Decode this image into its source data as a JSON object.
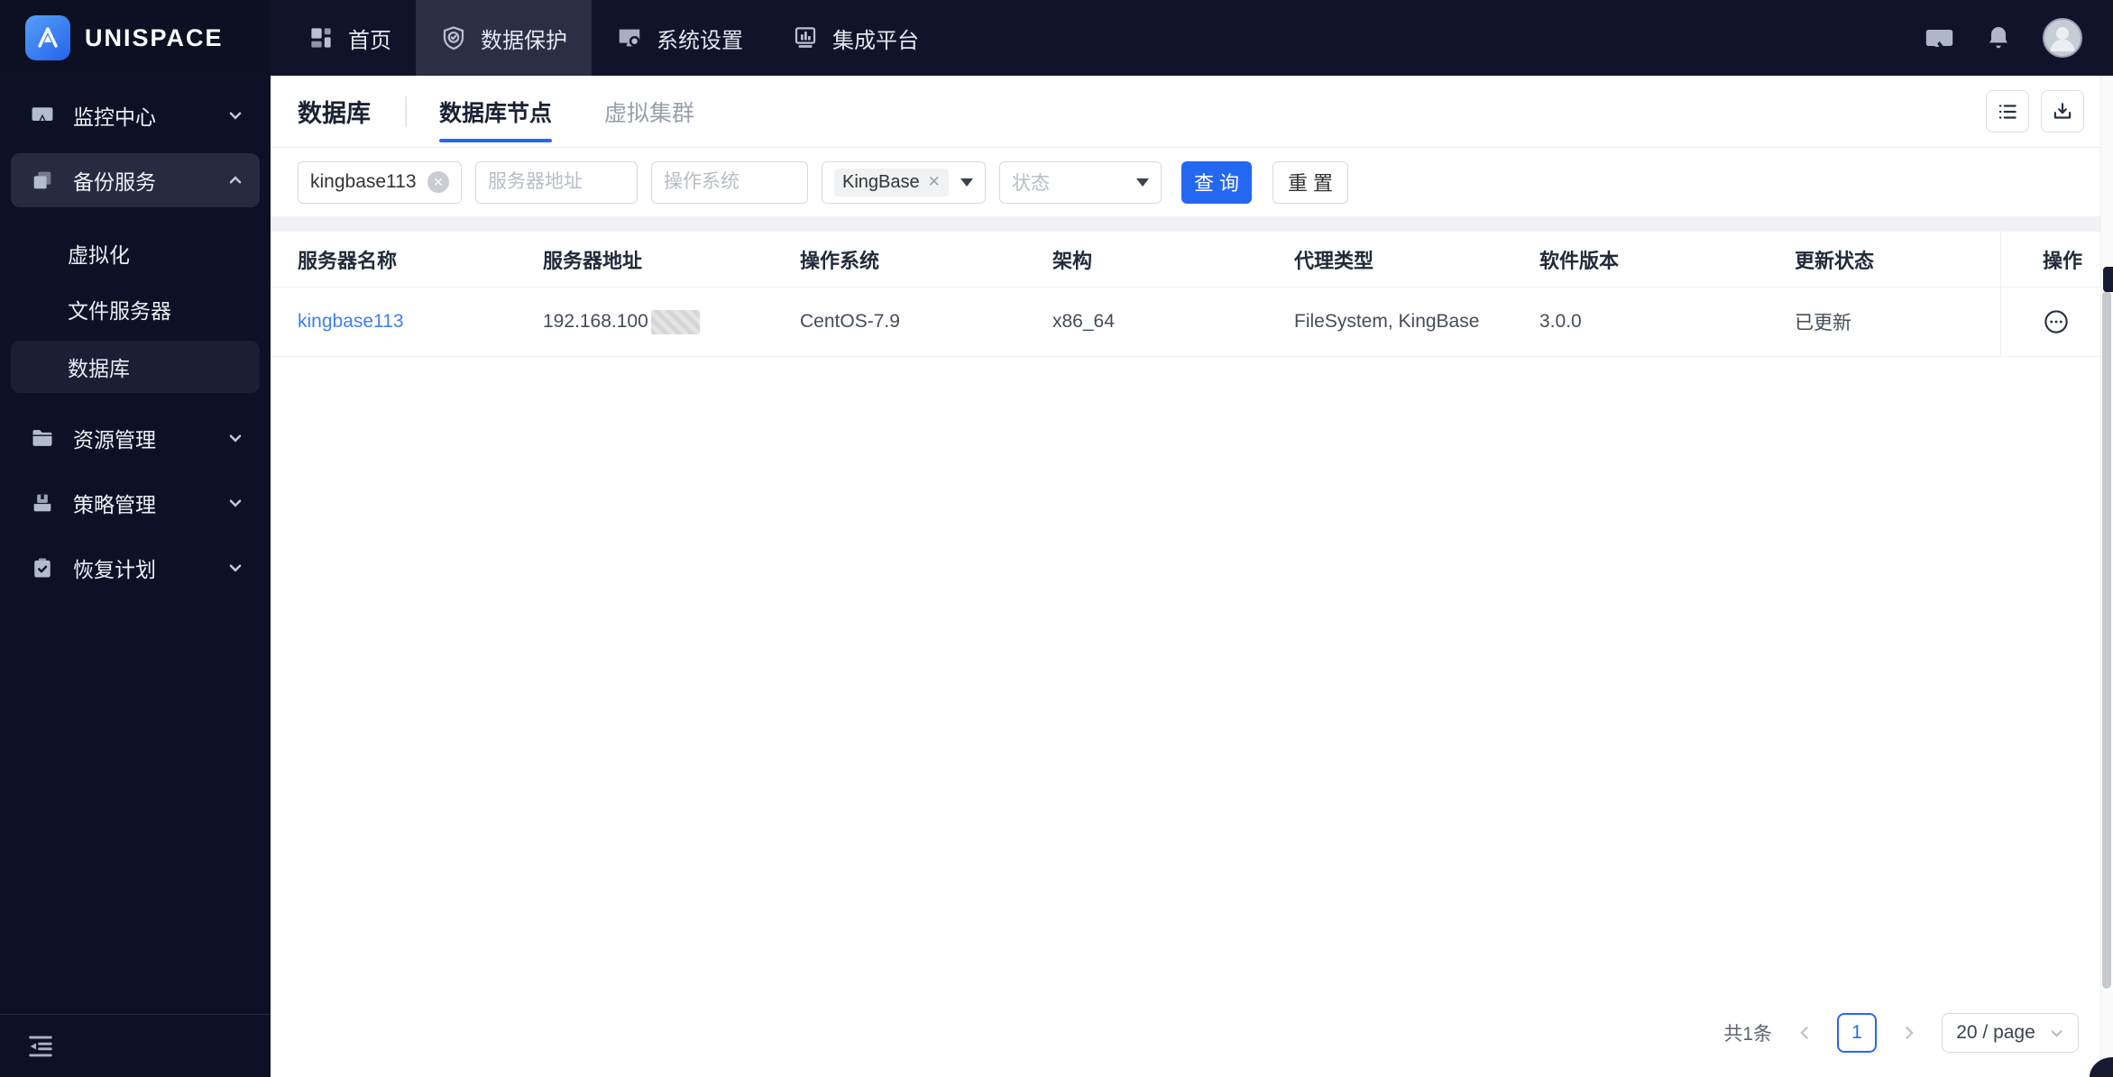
{
  "brand": {
    "name": "UNISPACE"
  },
  "topnav": {
    "items": [
      {
        "label": "首页",
        "icon": "dashboard-icon",
        "active": false
      },
      {
        "label": "数据保护",
        "icon": "shield-check-icon",
        "active": true
      },
      {
        "label": "系统设置",
        "icon": "system-settings-icon",
        "active": false
      },
      {
        "label": "集成平台",
        "icon": "integration-icon",
        "active": false
      }
    ]
  },
  "topbar_right": {
    "icons": [
      "message-icon",
      "bell-icon",
      "avatar"
    ]
  },
  "sidebar": {
    "items": [
      {
        "label": "监控中心",
        "icon": "monitor-icon",
        "chevron": "down"
      },
      {
        "label": "备份服务",
        "icon": "backup-copy-icon",
        "chevron": "up",
        "expanded": true,
        "children": [
          {
            "label": "虚拟化",
            "active": false
          },
          {
            "label": "文件服务器",
            "active": false
          },
          {
            "label": "数据库",
            "active": true
          }
        ]
      },
      {
        "label": "资源管理",
        "icon": "folder-icon",
        "chevron": "down"
      },
      {
        "label": "策略管理",
        "icon": "policy-archive-icon",
        "chevron": "down"
      },
      {
        "label": "恢复计划",
        "icon": "recovery-clipboard-icon",
        "chevron": "down"
      }
    ],
    "collapse_icon": "collapse-sidebar-icon"
  },
  "page": {
    "title": "数据库",
    "tabs": [
      {
        "label": "数据库节点",
        "active": true
      },
      {
        "label": "虚拟集群",
        "active": false
      }
    ],
    "toolbar_icons": [
      "list-view-icon",
      "download-icon"
    ]
  },
  "filters": {
    "server_name": {
      "value": "kingbase113"
    },
    "server_address": {
      "placeholder": "服务器地址"
    },
    "os": {
      "placeholder": "操作系统"
    },
    "agent_type": {
      "tag": "KingBase"
    },
    "status": {
      "placeholder": "状态"
    },
    "search_label": "查 询",
    "reset_label": "重 置"
  },
  "table": {
    "columns": [
      "服务器名称",
      "服务器地址",
      "操作系统",
      "架构",
      "代理类型",
      "软件版本",
      "更新状态",
      "操作"
    ],
    "rows": [
      {
        "server_name": "kingbase113",
        "server_address_prefix": "192.168.100",
        "server_address_redacted": true,
        "os": "CentOS-7.9",
        "arch": "x86_64",
        "agent_type": "FileSystem, KingBase",
        "version": "3.0.0",
        "update_status": "已更新",
        "action_icon": "ellipsis-circle-icon"
      }
    ]
  },
  "pagination": {
    "total": "共1条",
    "current_page": "1",
    "page_size": "20 / page"
  },
  "icons_unicode": {
    "dashboard-icon": "▦",
    "shield-check-icon": "🛡",
    "system-settings-icon": "🖥",
    "integration-icon": "📊",
    "message-icon": "🖵",
    "bell-icon": "🔔",
    "avatar": "👤",
    "monitor-icon": "🖥",
    "backup-copy-icon": "⧉",
    "folder-icon": "📁",
    "policy-archive-icon": "🗃",
    "recovery-clipboard-icon": "📋",
    "chevron-down": "⌄",
    "chevron-up": "⌃",
    "list-view-icon": "☰",
    "download-icon": "⭳",
    "clear-circle-icon": "⊗",
    "caret-down": "▼",
    "ellipsis-circle-icon": "⊙",
    "collapse-sidebar-icon": "⇤",
    "page-prev": "‹",
    "page-next": "›"
  },
  "colors": {
    "topbar_bg": "#10142b",
    "brand_bg": "#0c1022",
    "sidebar_bg": "#0d1126",
    "nav_active_bg": "#2a2f45",
    "primary_blue": "#2468f2",
    "link_blue": "#3f7ef7",
    "page_bg": "#f0f2f5",
    "card_bg": "#ffffff"
  }
}
